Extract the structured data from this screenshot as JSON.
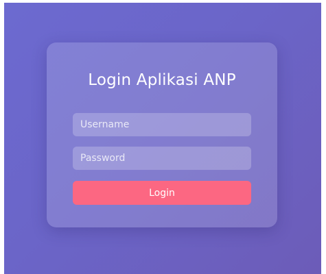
{
  "login": {
    "title": "Login Aplikasi ANP",
    "username_placeholder": "Username",
    "password_placeholder": "Password",
    "button_label": "Login"
  },
  "colors": {
    "background_gradient": [
      "#6c6ad0",
      "#6c5cb8"
    ],
    "button": "#fc6782",
    "text": "#ffffff"
  }
}
